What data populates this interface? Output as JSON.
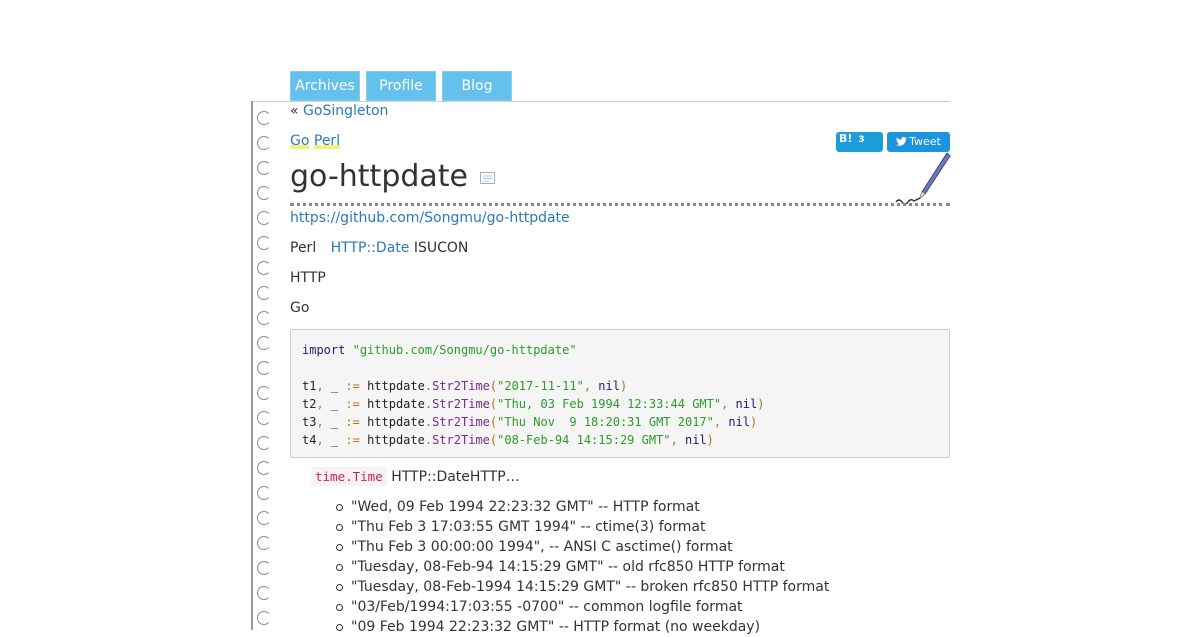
{
  "nav": {
    "tabs": [
      "Archives",
      "Profile",
      "Blog"
    ]
  },
  "entry": {
    "prev_marker": "«",
    "prev_title": "GoSingleton",
    "categories": [
      "Go",
      "Perl"
    ],
    "title": "go-httpdate",
    "url": "https://github.com/Songmu/go-httpdate",
    "p1_prefix": "Perl",
    "p1_link": "HTTP::Date",
    "p1_suffix": "ISUCON",
    "p2": "HTTP",
    "p3": "Go",
    "inline_code": "time.Time",
    "p4_suffix": "HTTP::DateHTTP…"
  },
  "social": {
    "hatena_label": "B!",
    "hatena_count": "3",
    "tweet_label": "Tweet"
  },
  "code": {
    "import_kw": "import",
    "import_path": "\"github.com/Songmu/go-httpdate\"",
    "lines": [
      {
        "var": "t1",
        "arg": "\"2017-11-11\""
      },
      {
        "var": "t2",
        "arg": "\"Thu, 03 Feb 1994 12:33:44 GMT\""
      },
      {
        "var": "t3",
        "arg": "\"Thu Nov  9 18:20:31 GMT 2017\""
      },
      {
        "var": "t4",
        "arg": "\"08-Feb-94 14:15:29 GMT\""
      }
    ],
    "pkg": "httpdate",
    "func": "Str2Time",
    "nil": "nil",
    "assign": ":=",
    "blank": "_"
  },
  "formats": [
    "\"Wed, 09 Feb 1994 22:23:32 GMT\" -- HTTP format",
    "\"Thu Feb 3 17:03:55 GMT 1994\" -- ctime(3) format",
    "\"Thu Feb 3 00:00:00 1994\", -- ANSI C asctime() format",
    "\"Tuesday, 08-Feb-94 14:15:29 GMT\" -- old rfc850 HTTP format",
    "\"Tuesday, 08-Feb-1994 14:15:29 GMT\" -- broken rfc850 HTTP format",
    "\"03/Feb/1994:17:03:55 -0700\" -- common logfile format",
    "\"09 Feb 1994 22:23:32 GMT\" -- HTTP format (no weekday)"
  ],
  "colors": {
    "nav_tab": "#64c1ee",
    "link": "#2a7ab8",
    "hatena": "#1e9ddc",
    "twitter": "#1b95e0"
  }
}
